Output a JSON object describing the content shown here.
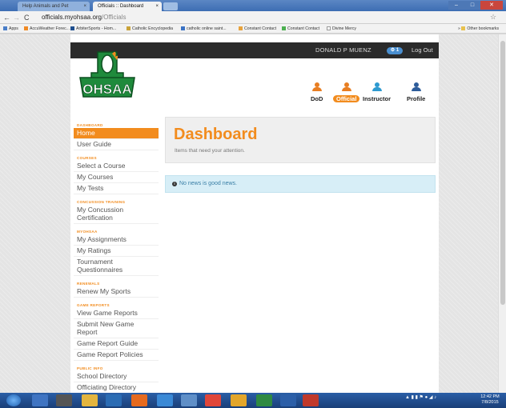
{
  "browser": {
    "tabs": [
      {
        "label": "Help Animals and Pet",
        "close": "×"
      },
      {
        "label": "Officials :: Dashboard",
        "close": "×"
      }
    ],
    "url_host": "officials.myohsaa.org",
    "url_path": "/Officials",
    "bookmarks": [
      "Apps",
      "AccuWeather Forec...",
      "ArbiterSports - Hom...",
      "Catholic Encyclopedia",
      "catholic online saint...",
      "Constant Contact",
      "Constant Contact",
      "Divine Mercy"
    ],
    "other_bookmarks": "Other bookmarks"
  },
  "header": {
    "username": "DONALD P MUENZ",
    "notification_count": "1",
    "notification_icon": "gear-icon",
    "logout": "Log Out",
    "logo_text": "OHSAA",
    "roles": [
      {
        "label": "DoD",
        "color": "#e87e22"
      },
      {
        "label": "Official",
        "color": "#e87e22"
      },
      {
        "label": "Instructor",
        "color": "#2e9ad0"
      },
      {
        "label": "Profile",
        "color": "#2d5c9a"
      }
    ]
  },
  "sidebar": {
    "sections": [
      {
        "title": "DASHBOARD",
        "items": [
          "Home",
          "User Guide"
        ]
      },
      {
        "title": "COURSES",
        "items": [
          "Select a Course",
          "My Courses",
          "My Tests"
        ]
      },
      {
        "title": "CONCUSSION TRAINING",
        "items": [
          "My Concussion Certification"
        ]
      },
      {
        "title": "MYOHSAA",
        "items": [
          "My Assignments",
          "My Ratings",
          "Tournament Questionnaires"
        ]
      },
      {
        "title": "RENEWALS",
        "items": [
          "Renew My Sports"
        ]
      },
      {
        "title": "GAME REPORTS",
        "items": [
          "View Game Reports",
          "Submit New Game Report",
          "Game Report Guide",
          "Game Report Policies"
        ]
      },
      {
        "title": "PUBLIC INFO",
        "items": [
          "School Directory",
          "Officiating Directory"
        ]
      }
    ]
  },
  "main": {
    "title": "Dashboard",
    "subtitle": "Items that need your attention.",
    "news": "No news is good news."
  },
  "taskbar": {
    "time": "12:42 PM",
    "date": "7/8/2015"
  },
  "colors": {
    "accent": "#f28c1e",
    "topbar": "#2b2b2b",
    "info_bg": "#d7eef7"
  }
}
